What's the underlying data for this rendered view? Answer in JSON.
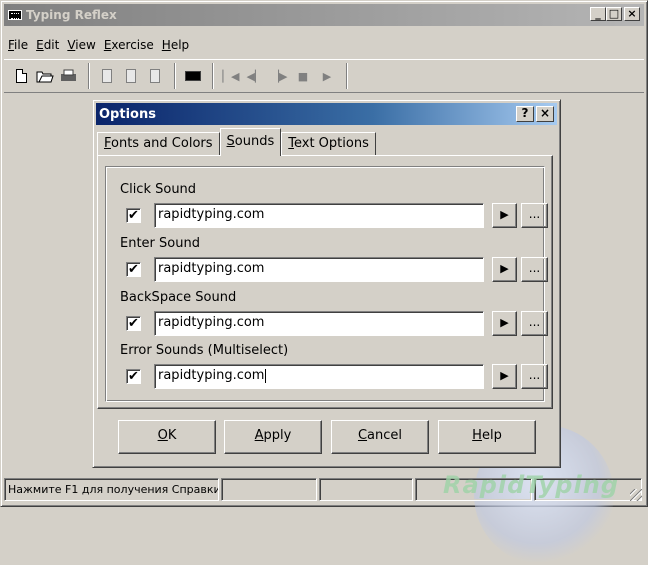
{
  "app": {
    "title": "Typing Reflex",
    "window_buttons": {
      "minimize": "_",
      "maximize": "□",
      "close": "×"
    }
  },
  "menu": [
    {
      "key": "F",
      "rest": "ile"
    },
    {
      "key": "E",
      "rest": "dit"
    },
    {
      "key": "V",
      "rest": "iew"
    },
    {
      "key": "E",
      "rest": "xercise",
      "pre": ""
    },
    {
      "key": "H",
      "rest": "elp"
    }
  ],
  "toolbar": {
    "icons": [
      "new-document-icon",
      "open-folder-icon",
      "print-icon",
      "page-icon",
      "page-icon",
      "page-icon",
      "keyboard-icon",
      "skip-start-icon",
      "step-back-icon",
      "step-forward-icon",
      "stop-icon",
      "play-icon"
    ]
  },
  "dialog": {
    "title": "Options",
    "help_label": "?",
    "close_label": "×",
    "tabs": [
      {
        "key": "F",
        "rest": "onts and Colors",
        "active": false
      },
      {
        "key": "S",
        "rest": "ounds",
        "active": true
      },
      {
        "key": "T",
        "rest": "ext Options",
        "active": false
      }
    ],
    "sounds": [
      {
        "label": "Click Sound",
        "checked": true,
        "value": "rapidtyping.com"
      },
      {
        "label": "Enter Sound",
        "checked": true,
        "value": "rapidtyping.com"
      },
      {
        "label": "BackSpace Sound",
        "checked": true,
        "value": "rapidtyping.com"
      },
      {
        "label": "Error Sounds (Multiselect)",
        "checked": true,
        "value": "rapidtyping.com"
      }
    ],
    "play_label": "▶",
    "browse_label": "...",
    "check_mark": "✔",
    "buttons": {
      "ok": {
        "key": "O",
        "rest": "K"
      },
      "apply": {
        "key": "A",
        "rest": "pply"
      },
      "cancel": {
        "key": "C",
        "rest": "ancel"
      },
      "help": {
        "key": "H",
        "rest": "elp"
      }
    }
  },
  "status": {
    "hint": "Нажмите F1 для получения Справки"
  },
  "watermark": "RapidTyping"
}
